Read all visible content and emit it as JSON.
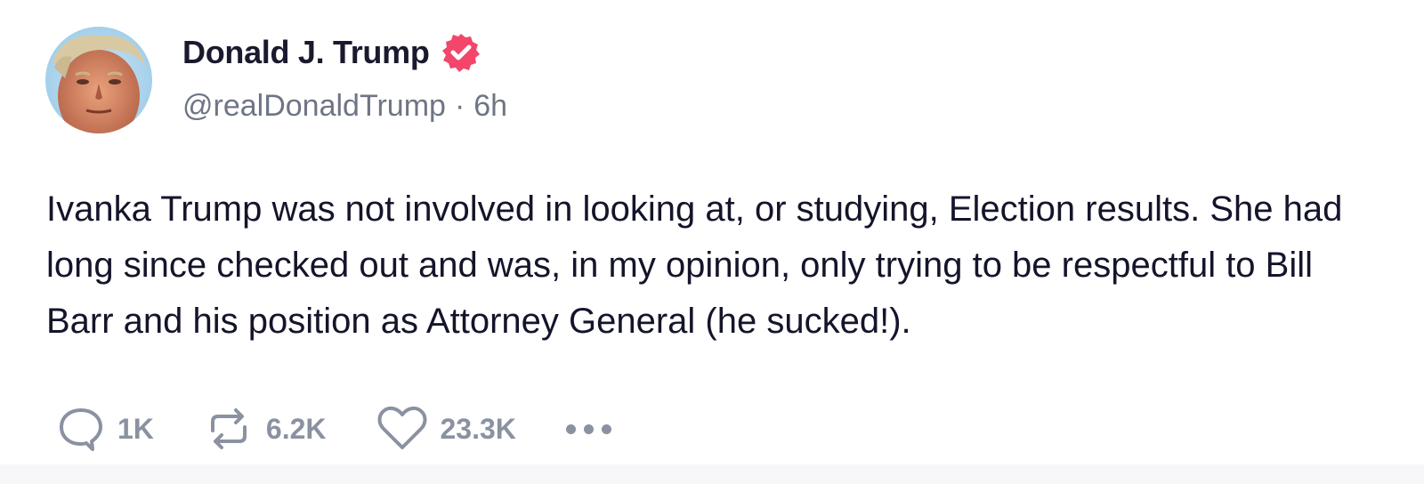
{
  "author": {
    "display_name": "Donald J. Trump",
    "handle": "@realDonaldTrump",
    "separator": "·",
    "time_ago": "6h",
    "verified": true,
    "verified_color": "#f3466a"
  },
  "post": {
    "text": "Ivanka Trump was not involved in looking at, or studying, Election results. She had long since checked out and was, in my opinion, only trying to be respectful to Bill Barr and his position as Attorney General (he sucked!)."
  },
  "actions": {
    "reply_count": "1K",
    "repost_count": "6.2K",
    "like_count": "23.3K",
    "icons": [
      "reply-icon",
      "repost-icon",
      "like-icon",
      "more-icon"
    ]
  },
  "colors": {
    "text_primary": "#14142b",
    "text_secondary": "#6e7584",
    "action_gray": "#8a91a0"
  }
}
